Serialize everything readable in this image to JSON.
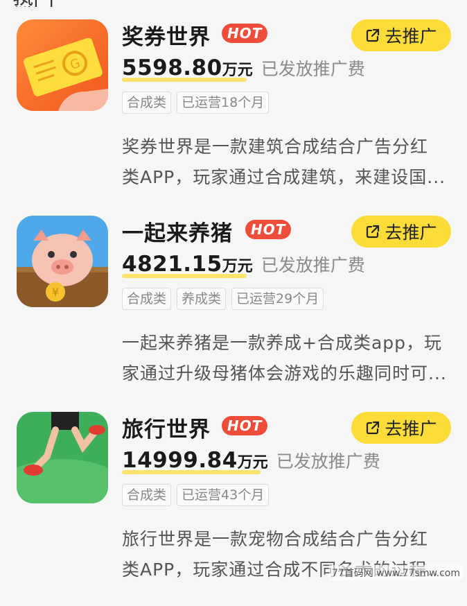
{
  "items": [
    {
      "title": "奖券世界",
      "hot": "HOT",
      "promote_label": "去推广",
      "amount": "5598.80",
      "unit": "万元",
      "amount_desc": "已发放推广费",
      "tags": [
        "合成类",
        "已运营18个月"
      ],
      "desc_lines": [
        "奖券世界是一款建筑合成结合广告分红",
        "类APP，玩家通过合成建筑，来建设国..."
      ],
      "icon": "lottery-ticket-icon"
    },
    {
      "title": "一起来养猪",
      "hot": "HOT",
      "promote_label": "去推广",
      "amount": "4821.15",
      "unit": "万元",
      "amount_desc": "已发放推广费",
      "tags": [
        "合成类",
        "养成类",
        "已运营29个月"
      ],
      "desc_lines": [
        "一起来养猪是一款养成+合成类app，玩",
        "家通过升级母猪体会游戏的乐趣同时可..."
      ],
      "icon": "pig-icon"
    },
    {
      "title": "旅行世界",
      "hot": "HOT",
      "promote_label": "去推广",
      "amount": "14999.84",
      "unit": "万元",
      "amount_desc": "已发放推广费",
      "tags": [
        "合成类",
        "已运营43个月"
      ],
      "desc_lines": [
        "旅行世界是一款宠物合成结合广告分红",
        "类APP，玩家通过合成不同名犬的过程..."
      ],
      "icon": "running-legs-icon"
    }
  ],
  "watermark": "77首码网 www.77smw.com",
  "colors": {
    "accent_yellow": "#fbdc38",
    "hot_red": "#ef4d3b",
    "underline": "#fbe36e"
  }
}
